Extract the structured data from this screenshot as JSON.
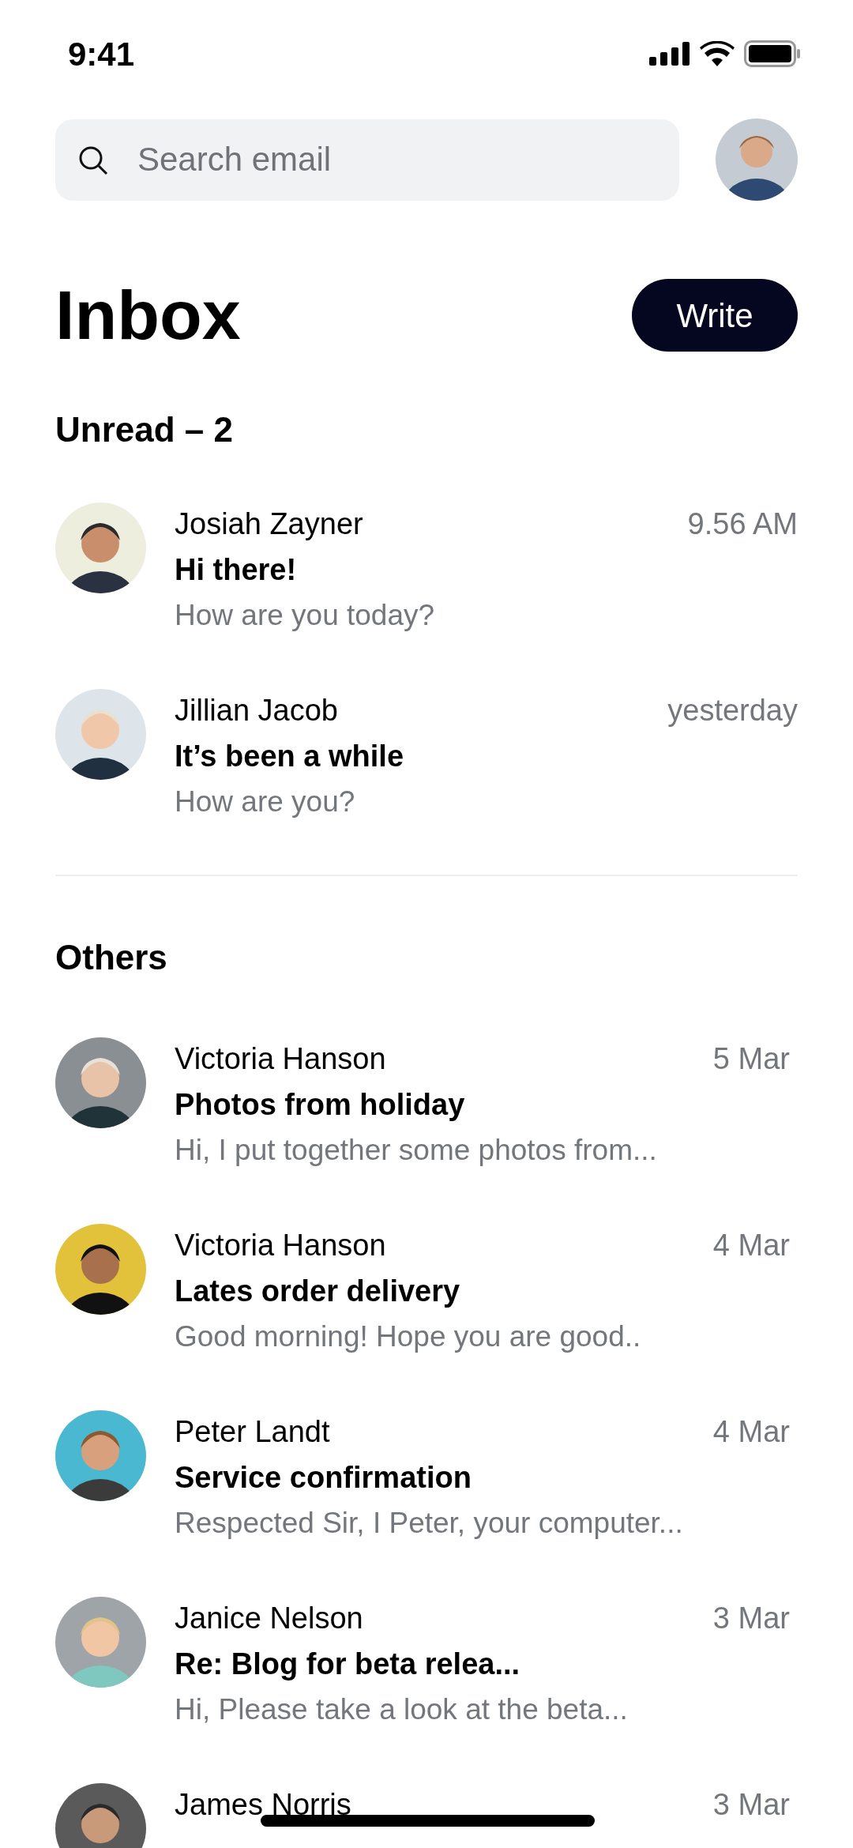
{
  "status_bar": {
    "time": "9:41"
  },
  "search": {
    "placeholder": "Search email"
  },
  "header": {
    "title": "Inbox",
    "write_button": "Write"
  },
  "sections": [
    {
      "title": "Unread – 2",
      "emails": [
        {
          "sender": "Josiah Zayner",
          "time": "9.56 AM",
          "subject": "Hi there!",
          "preview": "How are you today?"
        },
        {
          "sender": "Jillian Jacob",
          "time": "yesterday",
          "subject": "It’s been a while",
          "preview": "How are you?"
        }
      ]
    },
    {
      "title": "Others",
      "emails": [
        {
          "sender": "Victoria Hanson",
          "time": "5 Mar",
          "subject": "Photos from holiday",
          "preview": "Hi, I put together some photos from..."
        },
        {
          "sender": "Victoria Hanson",
          "time": "4 Mar",
          "subject": "Lates order delivery",
          "preview": "Good morning! Hope you are good.."
        },
        {
          "sender": "Peter Landt",
          "time": "4 Mar",
          "subject": "Service confirmation",
          "preview": "Respected Sir, I Peter, your computer..."
        },
        {
          "sender": "Janice Nelson",
          "time": "3 Mar",
          "subject": "Re: Blog for beta relea...",
          "preview": "Hi, Please take a look at the beta..."
        },
        {
          "sender": "James Norris",
          "time": "3 Mar"
        }
      ]
    }
  ]
}
